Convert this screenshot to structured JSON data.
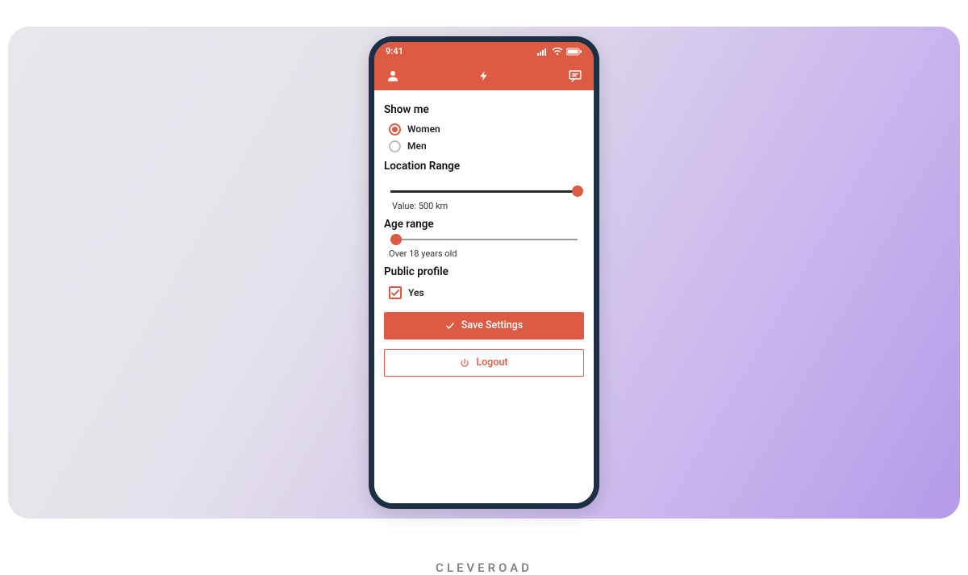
{
  "brand_watermark": "CLEVEROAD",
  "colors": {
    "accent": "#dd5a43",
    "frame": "#1d2f44"
  },
  "statusbar": {
    "time": "9:41"
  },
  "sections": {
    "show_me": {
      "title": "Show me",
      "options": [
        {
          "label": "Women",
          "selected": true
        },
        {
          "label": "Men",
          "selected": false
        }
      ]
    },
    "location": {
      "title": "Location Range",
      "value_label": "Value: 500 km",
      "percent": 100
    },
    "age": {
      "title": "Age range",
      "value_label": "Over 18 years old",
      "percent": 2
    },
    "public": {
      "title": "Public profile",
      "checkbox_label": "Yes",
      "checked": true
    }
  },
  "buttons": {
    "save": "Save Settings",
    "logout": "Logout"
  }
}
